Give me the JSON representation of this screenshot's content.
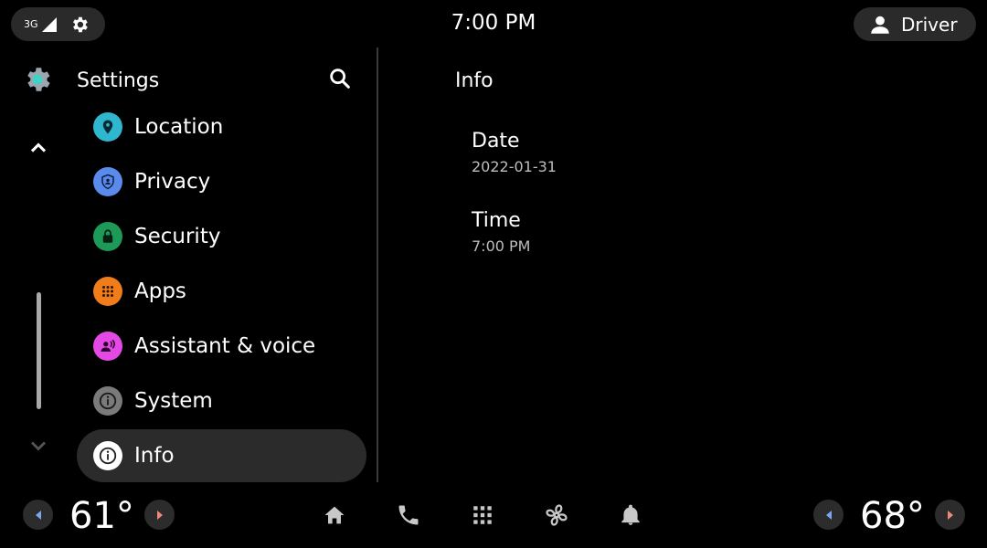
{
  "status_bar": {
    "network_label": "3G",
    "clock": "7:00 PM",
    "user_name": "Driver"
  },
  "settings_panel": {
    "title": "Settings",
    "items": [
      {
        "label": "Location",
        "icon": "location-icon",
        "color": "#2fb7d0"
      },
      {
        "label": "Privacy",
        "icon": "privacy-icon",
        "color": "#5a8bec"
      },
      {
        "label": "Security",
        "icon": "lock-icon",
        "color": "#1e9a58"
      },
      {
        "label": "Apps",
        "icon": "apps-grid-icon",
        "color": "#f07d1a"
      },
      {
        "label": "Assistant & voice",
        "icon": "assistant-icon",
        "color": "#e549e5"
      },
      {
        "label": "System",
        "icon": "info-icon",
        "color": "#7a7a7a"
      },
      {
        "label": "Info",
        "icon": "info-icon",
        "color": "#ffffff",
        "selected": true
      }
    ]
  },
  "detail_pane": {
    "title": "Info",
    "fields": [
      {
        "label": "Date",
        "value": "2022-01-31"
      },
      {
        "label": "Time",
        "value": "7:00 PM"
      }
    ]
  },
  "bottom_bar": {
    "left_temp": "61°",
    "right_temp": "68°",
    "nav_icons": [
      "home-icon",
      "phone-icon",
      "app-grid-icon",
      "fan-icon",
      "bell-icon"
    ]
  },
  "colors": {
    "background": "#000000",
    "pill": "#2a2a2a",
    "selected_item": "#2b2b2b",
    "arrow_left": "#7aa7ee",
    "arrow_right": "#ee8a7a"
  }
}
